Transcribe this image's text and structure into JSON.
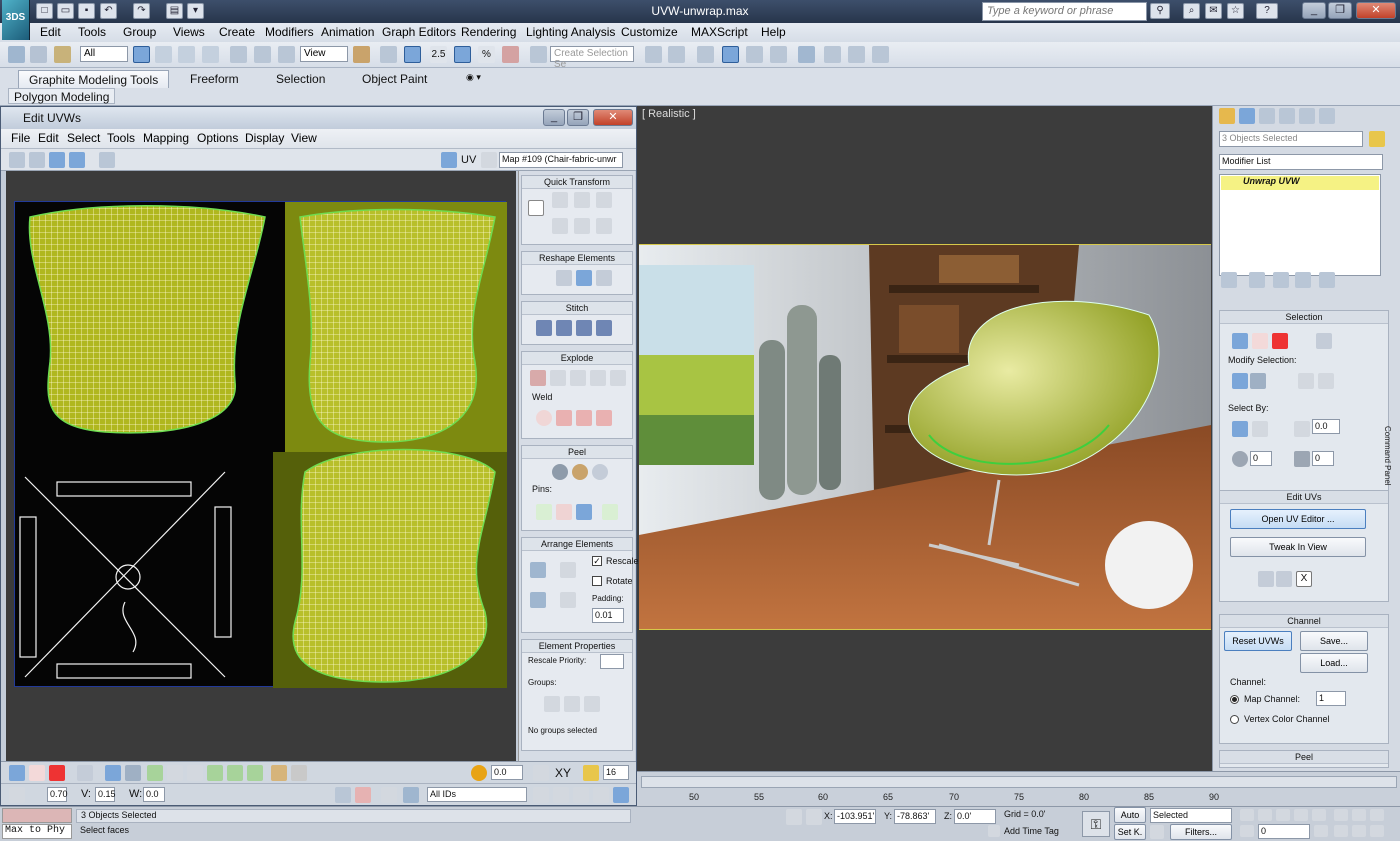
{
  "app": {
    "title": "UVW-unwrap.max",
    "search_placeholder": "Type a keyword or phrase",
    "logo_text": "3DS"
  },
  "menu": [
    "Edit",
    "Tools",
    "Group",
    "Views",
    "Create",
    "Modifiers",
    "Animation",
    "Graph Editors",
    "Rendering",
    "Lighting Analysis",
    "Customize",
    "MAXScript",
    "Help"
  ],
  "toolbar": {
    "selection_filter": "All",
    "ref_coord": "View",
    "named_selection_placeholder": "Create Selection Se",
    "snap_angle_label": "2.5",
    "percent_snap_label": "%"
  },
  "ribbon": {
    "tabs": [
      "Graphite Modeling Tools",
      "Freeform",
      "Selection",
      "Object Paint"
    ],
    "active_tab": "Graphite Modeling Tools",
    "subpanel": "Polygon Modeling"
  },
  "uv_editor": {
    "title": "Edit UVWs",
    "menu": [
      "File",
      "Edit",
      "Select",
      "Tools",
      "Mapping",
      "Options",
      "Display",
      "View"
    ],
    "mode_label": "UV",
    "map_dropdown": "Map #109 (Chair-fabric-unwr",
    "panel": {
      "quick_transform": "Quick Transform",
      "reshape_elements": "Reshape Elements",
      "stitch": "Stitch",
      "explode": "Explode",
      "weld": "Weld",
      "peel": "Peel",
      "pins": "Pins:",
      "arrange_elements": "Arrange Elements",
      "rescale": "Rescale",
      "rotate": "Rotate",
      "padding_label": "Padding:",
      "padding_value": "0.01",
      "element_properties": "Element Properties",
      "rescale_priority": "Rescale Priority:",
      "groups": "Groups:",
      "no_groups": "No groups selected"
    },
    "bottom": {
      "soft_value": "0.0",
      "xy_label": "XY",
      "grid_value": "16",
      "u_value": "0.70",
      "v_label": "V:",
      "v_value": "0.15",
      "w_label": "W:",
      "w_value": "0.0",
      "ids_dropdown": "All IDs"
    },
    "status_left": "3 Objects Selected",
    "status_prompt": "Select faces"
  },
  "viewport": {
    "label": "[ Realistic ]"
  },
  "command_panel": {
    "selection_name": "3 Objects Selected",
    "modifier_list": "Modifier List",
    "stack_item": "Unwrap UVW",
    "selection_title": "Selection",
    "modify_selection": "Modify Selection:",
    "select_by": "Select By:",
    "select_by_value": "0.0",
    "field_a": "0",
    "field_b": "0",
    "edit_uvs_title": "Edit UVs",
    "open_uv_editor": "Open UV Editor ...",
    "tweak_in_view": "Tweak In View",
    "channel_title": "Channel",
    "reset_uvws": "Reset UVWs",
    "save": "Save...",
    "load": "Load...",
    "channel_label": "Channel:",
    "map_channel": "Map Channel:",
    "map_channel_value": "1",
    "vertex_color_channel": "Vertex Color Channel",
    "peel_title": "Peel",
    "side_label": "Command Panel"
  },
  "timeline": {
    "ticks": [
      "50",
      "55",
      "60",
      "65",
      "70",
      "75",
      "80",
      "85",
      "90"
    ],
    "x_label": "X:",
    "x_value": "-103.951'",
    "y_label": "Y:",
    "y_value": "-78.863'",
    "z_label": "Z:",
    "z_value": "0.0'",
    "grid": "Grid = 0.0'",
    "add_time_tag": "Add Time Tag",
    "auto_key": "Auto",
    "set_key": "Set K.",
    "key_filter": "Selected",
    "filters": "Filters...",
    "frame_value": "0"
  },
  "status": {
    "script_listener": "Max to Phy",
    "prompt": "Select faces"
  }
}
